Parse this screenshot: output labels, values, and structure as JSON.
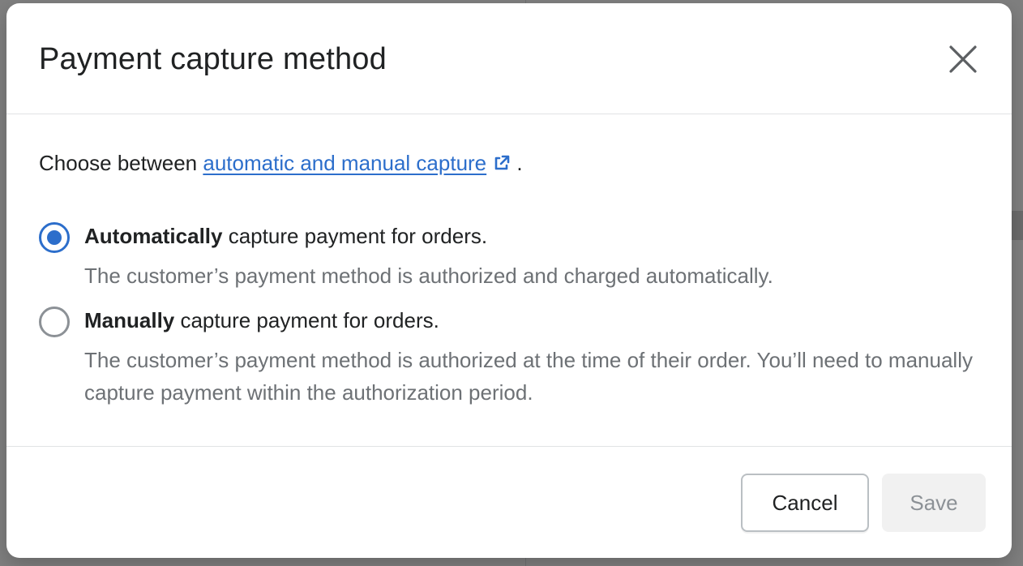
{
  "modal": {
    "title": "Payment capture method",
    "intro_prefix": "Choose between ",
    "intro_link": "automatic and manual capture",
    "intro_suffix": ".",
    "options": [
      {
        "label_bold": "Automatically",
        "label_rest": " capture payment for orders.",
        "help": "The customer’s payment method is authorized and charged automatically.",
        "selected": true
      },
      {
        "label_bold": "Manually",
        "label_rest": " capture payment for orders.",
        "help": "The customer’s payment method is authorized at the time of their order. You’ll need to manually capture payment within the authorization period.",
        "selected": false
      }
    ],
    "cancel_label": "Cancel",
    "save_label": "Save"
  },
  "icons": {
    "close": "close-icon",
    "external": "external-link-icon"
  },
  "colors": {
    "accent": "#2c6ecb",
    "text": "#202223",
    "subdued": "#6d7175",
    "disabled_bg": "#f1f1f1"
  }
}
